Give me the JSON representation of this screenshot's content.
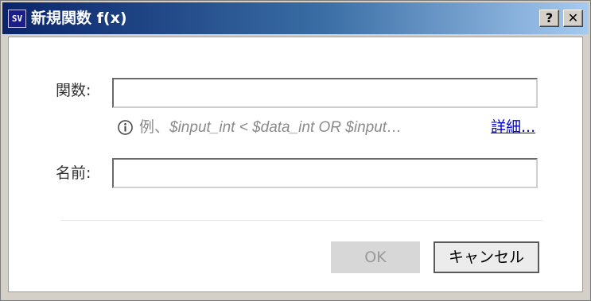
{
  "window": {
    "app_icon_text": "SV",
    "title": "新規関数 f(x)",
    "help_button": "?",
    "close_button": "✕"
  },
  "form": {
    "function_label": "関数:",
    "function_value": "",
    "hint_prefix": "例、",
    "hint_example": "$input_int < $data_int OR $input…",
    "detail_link": "詳細...",
    "name_label": "名前:",
    "name_value": ""
  },
  "buttons": {
    "ok": "OK",
    "cancel": "キャンセル"
  },
  "colors": {
    "title_bar_start": "#0a246a",
    "title_bar_end": "#a6caf0",
    "link": "#0000cc",
    "disabled_text": "#9a9a9a"
  },
  "icons": {
    "info": "info-circle-icon",
    "help": "question-mark-icon",
    "close": "close-x-icon"
  },
  "state": {
    "ok_enabled": false
  }
}
